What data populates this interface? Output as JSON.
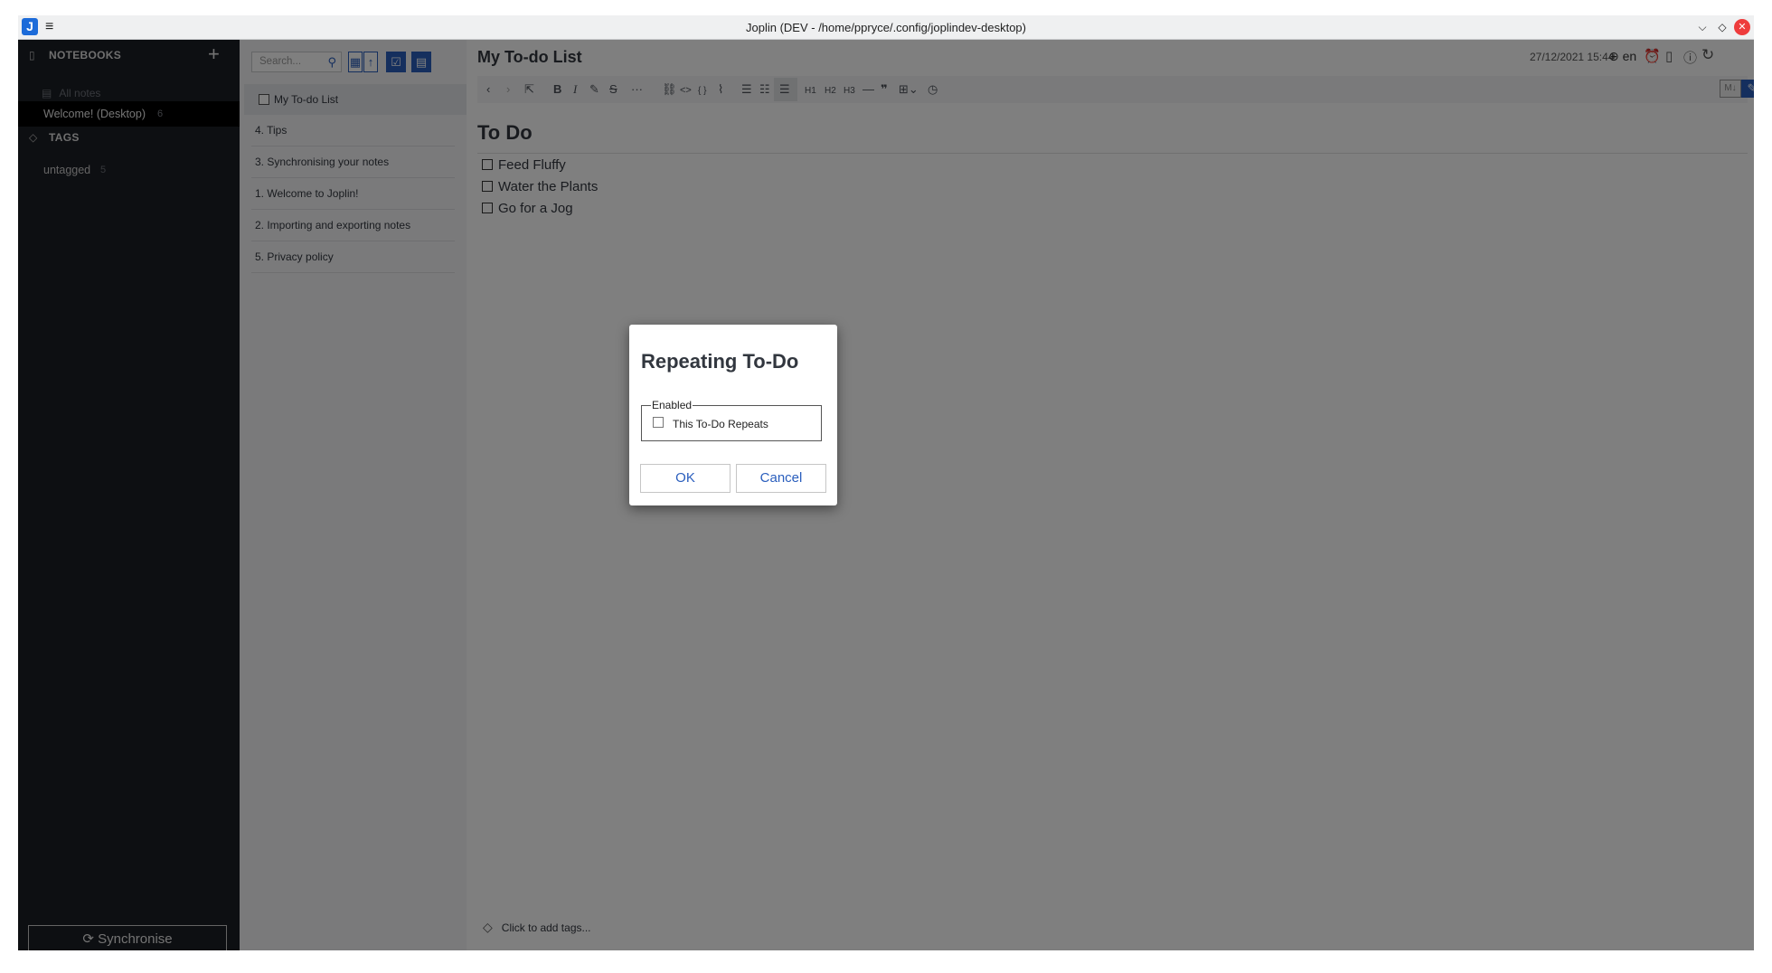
{
  "window": {
    "title": "Joplin (DEV - /home/ppryce/.config/joplindev-desktop)",
    "logo_letter": "J",
    "menu_glyph": "≡",
    "controls": {
      "minimize": "⌵",
      "maximize": "◇",
      "close": "✕"
    }
  },
  "sidebar": {
    "notebooks_header": "NOTEBOOKS",
    "add_icon": "+",
    "all_notes": "All notes",
    "notebook": {
      "label": "Welcome! (Desktop)",
      "count": "6"
    },
    "tags_header": "TAGS",
    "tag": {
      "label": "untagged",
      "count": "5"
    },
    "sync_label": "Synchronise",
    "icons": {
      "notebook": "notebook-icon",
      "all_notes": "notes-icon",
      "tags": "tag-icon",
      "sync": "sync-icon"
    }
  },
  "notelist": {
    "search_placeholder": "Search...",
    "items": [
      {
        "title": "My To-do List",
        "selected": true,
        "is_todo": true
      },
      {
        "title": "4. Tips"
      },
      {
        "title": "3. Synchronising your notes"
      },
      {
        "title": "1. Welcome to Joplin!"
      },
      {
        "title": "2. Importing and exporting notes"
      },
      {
        "title": "5. Privacy policy"
      }
    ]
  },
  "editor": {
    "note_title": "My To-do List",
    "date": "27/12/2021 15:44",
    "language": "en",
    "heading": "To Do",
    "todos": [
      "Feed Fluffy",
      "Water the Plants",
      "Go for a Jog"
    ],
    "tags_prompt": "Click to add tags...",
    "toolbar": {
      "h1": "H1",
      "h2": "H2",
      "h3": "H3",
      "bold": "B",
      "italic": "I",
      "more": "···",
      "quote": "❞",
      "code": "<>",
      "inline_code": "{ }"
    }
  },
  "dialog": {
    "title": "Repeating To-Do",
    "fieldset_legend": "Enabled",
    "checkbox_label": "This To-Do Repeats",
    "ok_label": "OK",
    "cancel_label": "Cancel"
  },
  "colors": {
    "accent": "#2a5ebd",
    "sidebar_bg": "#1b1e24",
    "selected_notebook_bg": "#000000",
    "notelist_bg": "#f4f5f6",
    "overlay": "rgba(0,0,0,0.5)",
    "close_button": "#ee3c3c"
  }
}
